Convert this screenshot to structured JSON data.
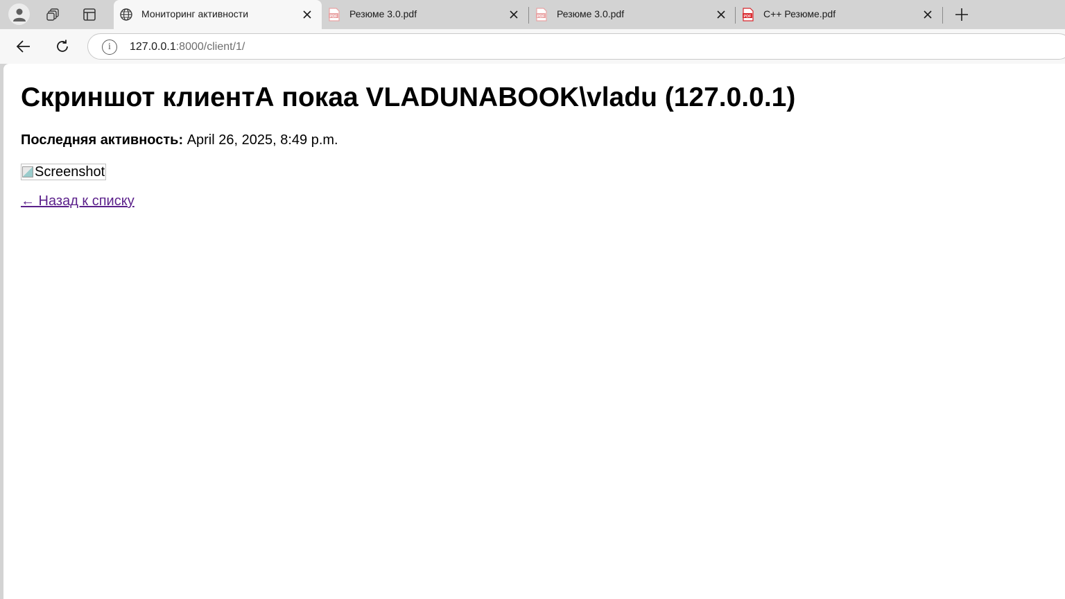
{
  "browser": {
    "tabs": [
      {
        "title": "Мониторинг активности",
        "icon": "globe-icon",
        "active": true
      },
      {
        "title": "Резюме 3.0.pdf",
        "icon": "pdf-icon",
        "active": false
      },
      {
        "title": "Резюме 3.0.pdf",
        "icon": "pdf-icon",
        "active": false
      },
      {
        "title": "C++ Резюме.pdf",
        "icon": "pdf-icon",
        "active": false
      }
    ],
    "address": {
      "host": "127.0.0.1",
      "rest": ":8000/client/1/"
    }
  },
  "page": {
    "title": "Скриншот клиентА покаа VLADUNABOOK\\vladu (127.0.0.1)",
    "activity_label": "Последняя активность:",
    "activity_value": "April 26, 2025, 8:49 p.m.",
    "image_alt": "Screenshot",
    "back_link": "← Назад к списку"
  },
  "colors": {
    "link_visited": "#5a1f8a",
    "pdf_red": "#d8262b",
    "pdf_faded": "#e9a3a4"
  }
}
